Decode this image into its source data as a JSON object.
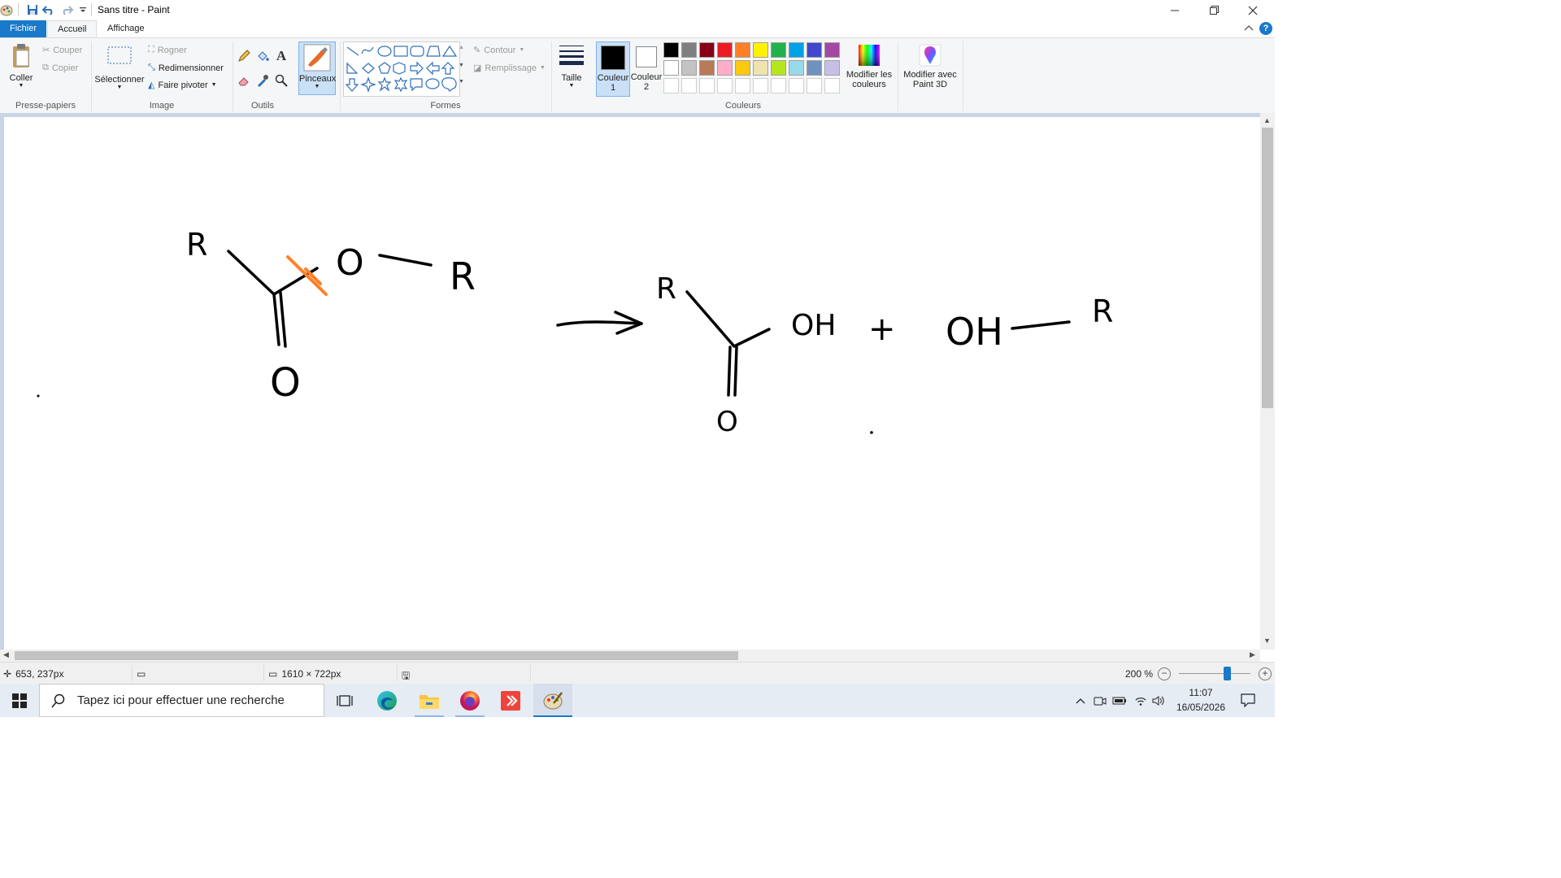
{
  "window": {
    "title": "Sans titre - Paint",
    "minimize": "—",
    "restore": "❐",
    "close": "✕"
  },
  "tabs": [
    "Fichier",
    "Accueil",
    "Affichage"
  ],
  "ribbon": {
    "clipboard": {
      "paste": "Coller",
      "cut": "Couper",
      "copy": "Copier",
      "group": "Presse-papiers"
    },
    "image": {
      "select": "Sélectionner",
      "crop": "Rogner",
      "resize": "Redimensionner",
      "rotate": "Faire pivoter",
      "group": "Image"
    },
    "tools": {
      "group": "Outils"
    },
    "brushes": {
      "label": "Pinceaux"
    },
    "shapes": {
      "outline": "Contour",
      "fill": "Remplissage",
      "group": "Formes"
    },
    "size": {
      "label": "Taille"
    },
    "colors": {
      "color1_label": "Couleur",
      "color1_num": "1",
      "color2_label": "Couleur",
      "color2_num": "2",
      "edit_colors_line1": "Modifier les",
      "edit_colors_line2": "couleurs",
      "group": "Couleurs",
      "color1_value": "#000000",
      "color2_value": "#ffffff",
      "palette_row1": [
        "#000000",
        "#7f7f7f",
        "#880015",
        "#ed1c24",
        "#ff7f27",
        "#fff200",
        "#22b14c",
        "#00a2e8",
        "#3f48cc",
        "#a349a4"
      ],
      "palette_row2": [
        "#ffffff",
        "#c3c3c3",
        "#b97a57",
        "#ffaec9",
        "#ffc90e",
        "#efe4b0",
        "#b5e61d",
        "#99d9ea",
        "#7092be",
        "#c8bfe7"
      ]
    },
    "paint3d": {
      "line1": "Modifier avec",
      "line2": "Paint 3D"
    }
  },
  "canvas": {
    "drawing": {
      "reactant": {
        "r_left": "R",
        "o_single": "O",
        "r_right": "R",
        "o_double": "O"
      },
      "product": {
        "r_top": "R",
        "oh": "OH",
        "o_double": "O",
        "plus": "+",
        "oh2": "OH",
        "r_right": "R"
      },
      "cross_color": "#ff7f27",
      "ink_color": "#000000"
    }
  },
  "status": {
    "cursor_pos": "653, 237px",
    "canvas_size": "1610 × 722px",
    "zoom": "200 %",
    "zoom_level_percent": 200
  },
  "taskbar": {
    "search_placeholder": "Tapez ici pour effectuer une recherche",
    "time": "11:07",
    "date": "16/05/2026"
  }
}
